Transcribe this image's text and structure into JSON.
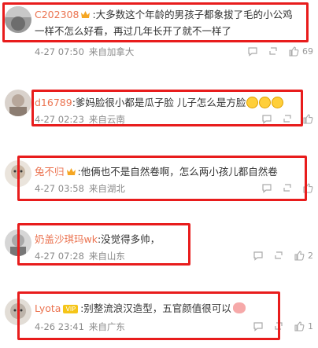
{
  "comments": [
    {
      "name": "C202308",
      "badge": "crown",
      "text_line1": ":大多数这个年龄的男孩子都象拔了毛的小公鸡",
      "text_line2": "一样不怎么好看，再过几年长开了就不一样了",
      "time": "4-27 07:50",
      "location": "来自加拿大",
      "likes": "69"
    },
    {
      "name": "d16789",
      "text": ":爹妈脸很小都是瓜子脸 儿子怎么是方脸",
      "emojis": [
        "emoji-face",
        "emoji-face",
        "emoji-face"
      ],
      "time": "4-27 02:23",
      "location": "来自云南",
      "likes": ""
    },
    {
      "name": "兔不归",
      "badge": "crown",
      "text": ":他俩也不是自然卷啊，怎么两小孩儿都自然卷",
      "time": "4-27 03:58",
      "location": "来自湖北",
      "likes": ""
    },
    {
      "name": "奶盖沙琪玛wk",
      "text": ":没觉得多帅，",
      "time": "4-27 07:28",
      "location": "来自山东",
      "likes": "2"
    },
    {
      "name": "Lyota",
      "badge": "vip",
      "vip_label": "VIP",
      "text": ":别整流浪汉造型，五官颜值很可以",
      "emojis": [
        "pig-emoji"
      ],
      "time": "4-26 23:41",
      "location": "来自广东",
      "likes": "1"
    }
  ],
  "colors": {
    "highlight": "#e81c1c",
    "username": "#eb7350",
    "meta": "#8a8a8a"
  },
  "icons": [
    "crown-icon",
    "reply-icon",
    "repost-icon",
    "like-icon"
  ]
}
